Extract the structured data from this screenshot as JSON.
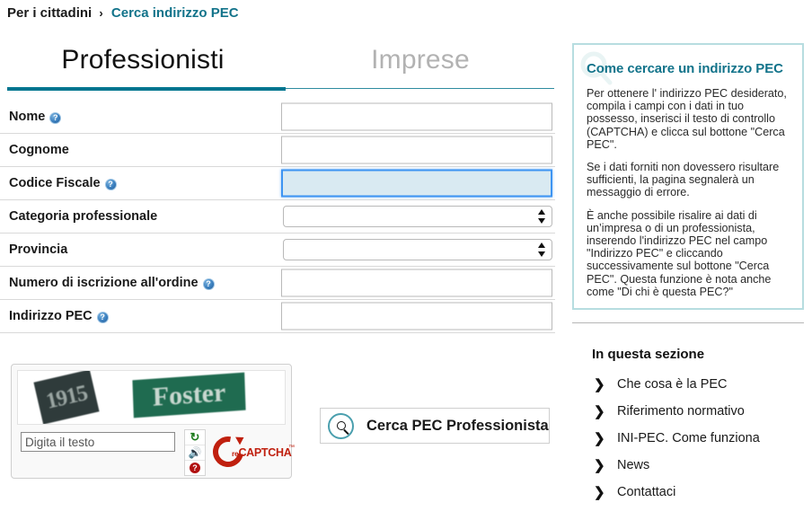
{
  "breadcrumb": {
    "root": "Per i cittadini",
    "separator": "›",
    "current": "Cerca indirizzo PEC"
  },
  "tabs": [
    {
      "label": "Professionisti",
      "active": true
    },
    {
      "label": "Imprese",
      "active": false
    }
  ],
  "form": {
    "fields": [
      {
        "label": "Nome",
        "help": true,
        "type": "text",
        "value": "",
        "focused": false
      },
      {
        "label": "Cognome",
        "help": false,
        "type": "text",
        "value": "",
        "focused": false
      },
      {
        "label": "Codice Fiscale",
        "help": true,
        "type": "text",
        "value": "",
        "focused": true
      },
      {
        "label": "Categoria professionale",
        "help": false,
        "type": "select",
        "value": ""
      },
      {
        "label": "Provincia",
        "help": false,
        "type": "select",
        "value": ""
      },
      {
        "label": "Numero di iscrizione all'ordine",
        "help": true,
        "type": "text",
        "value": "",
        "focused": false
      },
      {
        "label": "Indirizzo PEC",
        "help": true,
        "type": "text",
        "value": "",
        "focused": false
      }
    ]
  },
  "captcha": {
    "word1": "1915",
    "word2": "Foster",
    "input_placeholder": "Digita il testo",
    "input_value": "",
    "brand": "CAPTCHA",
    "brand_prefix": "re",
    "trademark": "™",
    "buttons": [
      {
        "name": "refresh",
        "glyph": "↻"
      },
      {
        "name": "audio",
        "glyph": "🔈"
      },
      {
        "name": "help",
        "glyph": "?"
      }
    ]
  },
  "search_button": {
    "label": "Cerca PEC Professionista",
    "icon": "search-icon"
  },
  "info_box": {
    "title": "Come cercare un indirizzo PEC",
    "paragraphs": [
      "Per ottenere l' indirizzo PEC desiderato, compila i campi con i dati in tuo possesso, inserisci il testo di controllo (CAPTCHA) e clicca sul bottone \"Cerca PEC\".",
      "Se i dati forniti non dovessero risultare sufficienti, la pagina segnalerà un messaggio di errore.",
      "È anche possibile risalire ai dati di un’impresa o di un professionista, inserendo l'indirizzo PEC nel campo \"Indirizzo PEC\" e cliccando successivamente  sul bottone \"Cerca PEC\". Questa funzione è nota anche come \"Di chi è questa PEC?\""
    ]
  },
  "section": {
    "title": "In questa sezione",
    "items": [
      {
        "label": "Che cosa è la PEC"
      },
      {
        "label": "Riferimento normativo"
      },
      {
        "label": "INI-PEC. Come funziona"
      },
      {
        "label": "News"
      },
      {
        "label": "Contattaci"
      }
    ]
  },
  "colors": {
    "accent_teal": "#12738a",
    "tab_underline": "#00758f",
    "info_border": "#b7dde0",
    "focus_blue": "#3d94f2",
    "recaptcha_red": "#c0200f"
  }
}
